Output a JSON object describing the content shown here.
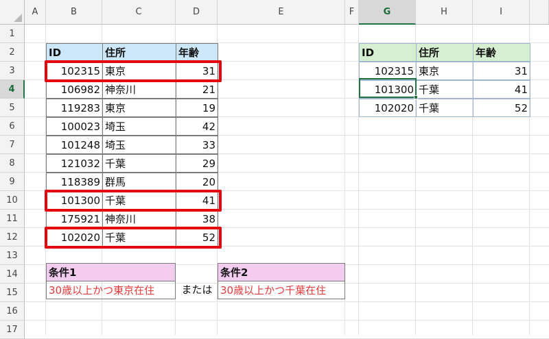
{
  "columns": [
    "A",
    "B",
    "C",
    "D",
    "E",
    "F",
    "G",
    "H",
    "I"
  ],
  "rows": [
    "1",
    "2",
    "3",
    "4",
    "5",
    "6",
    "7",
    "8",
    "9",
    "10",
    "11",
    "12",
    "13",
    "14",
    "15",
    "16",
    "17"
  ],
  "selected_column": "G",
  "selected_row": "4",
  "left_table": {
    "headers": [
      "ID",
      "住所",
      "年齢"
    ],
    "rows": [
      [
        "102315",
        "東京",
        "31"
      ],
      [
        "106982",
        "神奈川",
        "21"
      ],
      [
        "119283",
        "東京",
        "19"
      ],
      [
        "100023",
        "埼玉",
        "42"
      ],
      [
        "101248",
        "埼玉",
        "33"
      ],
      [
        "121032",
        "千葉",
        "29"
      ],
      [
        "118389",
        "群馬",
        "20"
      ],
      [
        "101300",
        "千葉",
        "41"
      ],
      [
        "175921",
        "神奈川",
        "38"
      ],
      [
        "102020",
        "千葉",
        "52"
      ]
    ],
    "highlighted_rows": [
      0,
      7,
      9
    ],
    "header_color": "#cce8f8"
  },
  "right_table": {
    "headers": [
      "ID",
      "住所",
      "年齢"
    ],
    "rows": [
      [
        "102315",
        "東京",
        "31"
      ],
      [
        "101300",
        "千葉",
        "41"
      ],
      [
        "102020",
        "千葉",
        "52"
      ]
    ],
    "header_color": "#d6efd0"
  },
  "condition1": {
    "label": "条件1",
    "text": "30歳以上かつ東京在住"
  },
  "connector": "または",
  "condition2": {
    "label": "条件2",
    "text": "30歳以上かつ千葉在住"
  },
  "condition_header_color": "#f2cdf0",
  "condition_text_color": "#e23a3a",
  "highlight_color": "#e5000e",
  "selection_color": "#217346"
}
